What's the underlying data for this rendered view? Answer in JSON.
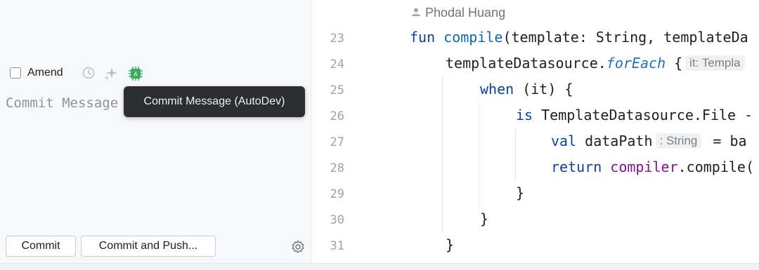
{
  "commit_panel": {
    "amend_label": "Amend",
    "commit_placeholder": "Commit Message",
    "tooltip": "Commit Message (AutoDev)",
    "commit_button": "Commit",
    "commit_push_button": "Commit and Push..."
  },
  "editor": {
    "author": "Phodal Huang",
    "lines": [
      {
        "num": "23"
      },
      {
        "num": "24"
      },
      {
        "num": "25"
      },
      {
        "num": "26"
      },
      {
        "num": "27"
      },
      {
        "num": "28"
      },
      {
        "num": "29"
      },
      {
        "num": "30"
      },
      {
        "num": "31"
      }
    ],
    "code": {
      "l23_kw": "fun",
      "l23_fn": "compile",
      "l23_rest": "(template: String, templateDa",
      "l24_a": "templateDatasource.",
      "l24_b": "forEach",
      "l24_c": " {",
      "l24_hint": "it: Templa",
      "l25_kw": "when",
      "l25_rest": " (it) {",
      "l26_kw": "is",
      "l26_rest": " TemplateDatasource.File -",
      "l27_kw": "val",
      "l27_a": " dataPath",
      "l27_hint": ": String",
      "l27_b": " = ba",
      "l28_kw": "return",
      "l28_purple": "compiler",
      "l28_rest": ".compile(",
      "l29": "}",
      "l30": "}",
      "l31": "}"
    }
  },
  "colors": {
    "keyword": "#0b3fa8",
    "tooltip_bg": "#2b2d30",
    "autodev_icon": "#3daa62"
  }
}
